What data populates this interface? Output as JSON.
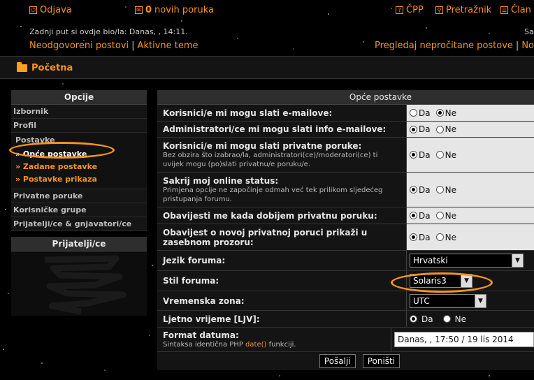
{
  "header": {
    "logout": "Odjava",
    "pm_count": "0",
    "pm_text": "novih poruka",
    "faq": "ČPP",
    "search": "Pretražnik",
    "members": "Član",
    "last_visit": "Zadnji put si ovdje bio/la: Danas, , 14:11.",
    "last_visit_right": "Sa",
    "unanswered": "Neodgovoreni postovi",
    "separator": "|",
    "active_topics": "Aktivne teme",
    "view_unread": "Pregledaj nepročitane postove",
    "new_right": "Nov"
  },
  "breadcrumb": {
    "home": "Početna"
  },
  "sidebar": {
    "options_title": "Opcije",
    "items": [
      "Izbornik",
      "Profil"
    ],
    "postavke_label": "Postavke",
    "sub_items": [
      "» Opće postavke",
      "» Zadane postavke",
      "» Postavke prikaza"
    ],
    "items2": [
      "Privatne poruke",
      "Korisničke grupe",
      "Prijatelji/ce & gnjavatori/ce"
    ],
    "friends_title": "Prijatelji/ce"
  },
  "form": {
    "title": "Opće postavke",
    "yes": "Da",
    "no": "Ne",
    "rows": [
      {
        "label": "Korisnici/e mi mogu slati e-mailove:",
        "explain": "",
        "selected": "Ne"
      },
      {
        "label": "Administratori/ce mi mogu slati info e-mailove:",
        "explain": "",
        "selected": "Da"
      },
      {
        "label": "Korisnici/e mi mogu slati privatne poruke:",
        "explain": "Bez obzira što izabrao/la, administratori(ce)/moderatori(ce) ti uvijek mogu (po)slati privatnu/e poruku/e.",
        "selected": "Da"
      },
      {
        "label": "Sakrij moj online status:",
        "explain": "Primjena opcije ne započinje odmah već tek prilikom sljedećeg pristupanja forumu.",
        "selected": "Da"
      },
      {
        "label": "Obavijesti me kada dobijem privatnu poruku:",
        "explain": "",
        "selected": "Da"
      },
      {
        "label": "Obavijest o novoj privatnoj poruci prikaži u zasebnom prozoru:",
        "explain": "",
        "selected": "Da"
      }
    ],
    "language_label": "Jezik foruma:",
    "language_value": "Hrvatski",
    "style_label": "Stil foruma:",
    "style_value": "Solaris3",
    "timezone_label": "Vremenska zona:",
    "timezone_value": "UTC",
    "dst_label": "Ljetno vrijeme [LJV]:",
    "dst_selected": "Da",
    "date_label": "Format datuma:",
    "date_explain_pre": "Sintaksa identična PHP",
    "date_link": "date()",
    "date_explain_post": "funkciji.",
    "date_value": "Danas, , 17:50 / 19 lis 2014",
    "submit": "Pošalji",
    "reset": "Poništi"
  },
  "colors": {
    "accent": "#f7941d",
    "background": "#000000",
    "panel": "#141414"
  }
}
